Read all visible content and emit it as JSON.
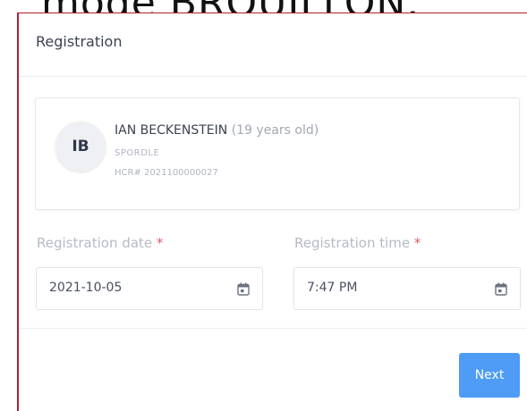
{
  "overlay": {
    "top_text": "mode BROUILLON."
  },
  "panel": {
    "title": "Registration"
  },
  "member": {
    "initials": "IB",
    "name": "IAN BECKENSTEIN",
    "age": "(19 years old)",
    "organization": "SPORDLE",
    "hcr": "HCR# 2021100000027"
  },
  "form": {
    "date_label": "Registration date",
    "date_value": "2021-10-05",
    "time_label": "Registration time",
    "time_value": "7:47 PM",
    "required_marker": "*"
  },
  "actions": {
    "next_label": "Next"
  },
  "colors": {
    "primary": "#4e9cf5",
    "required": "#e25a64",
    "border_accent": "#b02030"
  }
}
